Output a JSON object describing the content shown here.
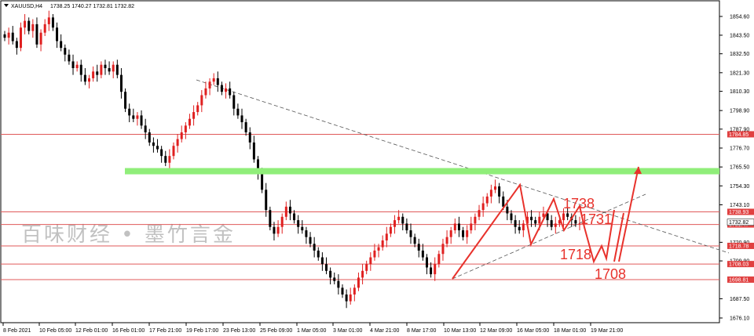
{
  "chart_data": {
    "type": "candlestick",
    "symbol_line": {
      "symbol": "XAUUSD,H4",
      "ohlc": "1738.25 1740.27 1732.81 1732.82"
    },
    "ylim": [
      1671.0,
      1864.0
    ],
    "y_ticks": [
      "1854.60",
      "1843.50",
      "1832.50",
      "1821.30",
      "1810.30",
      "1798.90",
      "1787.90",
      "1776.70",
      "1765.50",
      "1754.30",
      "1743.10",
      "1720.90",
      "1709.90",
      "1687.50",
      "1676.10"
    ],
    "x_ticks": [
      "8 Feb 2021",
      "10 Feb 05:00",
      "12 Feb 01:00",
      "16 Feb 01:00",
      "17 Feb 21:00",
      "19 Feb 17:00",
      "23 Feb 13:00",
      "25 Feb 09:00",
      "1 Mar 05:00",
      "3 Mar 01:00",
      "4 Mar 21:00",
      "8 Mar 17:00",
      "10 Mar 13:00",
      "12 Mar 09:00",
      "16 Mar 05:00",
      "18 Mar 01:00",
      "19 Mar 21:00"
    ],
    "price_lines": [
      {
        "price": 1784.85,
        "label": "1784.85"
      },
      {
        "price": 1738.93,
        "label": "1738.93"
      },
      {
        "price": 1731.47,
        "label": "1731.47"
      },
      {
        "price": 1718.78,
        "label": "1718.78"
      },
      {
        "price": 1708.03,
        "label": "1708.03"
      },
      {
        "price": 1698.81,
        "label": "1698.81"
      }
    ],
    "current_price": {
      "price": 1732.82,
      "label": "1732.82"
    },
    "support_zone": {
      "price": 1763.0
    },
    "candles_close": [
      1842,
      1845,
      1840,
      1836,
      1848,
      1852,
      1846,
      1850,
      1838,
      1845,
      1850,
      1854,
      1848,
      1840,
      1836,
      1832,
      1828,
      1824,
      1826,
      1820,
      1816,
      1818,
      1822,
      1820,
      1826,
      1824,
      1822,
      1826,
      1820,
      1810,
      1800,
      1796,
      1794,
      1796,
      1790,
      1786,
      1780,
      1778,
      1776,
      1772,
      1768,
      1772,
      1778,
      1782,
      1786,
      1790,
      1794,
      1798,
      1802,
      1808,
      1812,
      1816,
      1818,
      1814,
      1810,
      1812,
      1808,
      1800,
      1796,
      1792,
      1786,
      1780,
      1770,
      1762,
      1752,
      1740,
      1730,
      1726,
      1730,
      1736,
      1742,
      1738,
      1734,
      1730,
      1728,
      1724,
      1720,
      1716,
      1712,
      1708,
      1704,
      1700,
      1698,
      1694,
      1690,
      1686,
      1690,
      1694,
      1700,
      1704,
      1708,
      1712,
      1716,
      1718,
      1722,
      1726,
      1730,
      1734,
      1736,
      1732,
      1728,
      1724,
      1720,
      1716,
      1712,
      1706,
      1702,
      1708,
      1714,
      1720,
      1724,
      1728,
      1732,
      1728,
      1724,
      1728,
      1732,
      1736,
      1740,
      1744,
      1748,
      1752,
      1754,
      1748,
      1742,
      1738,
      1734,
      1730,
      1728,
      1732,
      1736,
      1734,
      1732,
      1736,
      1738,
      1734,
      1730,
      1732,
      1734,
      1738,
      1736,
      1734,
      1732,
      1732
    ],
    "annotations": [
      "1738",
      "1731",
      "1718",
      "1708"
    ],
    "watermark": "百味财经 • 墨竹言金"
  }
}
